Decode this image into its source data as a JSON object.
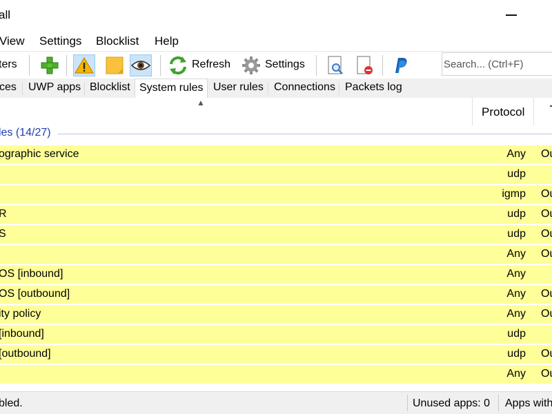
{
  "window": {
    "title": "all"
  },
  "menu": {
    "items": [
      "View",
      "Settings",
      "Blocklist",
      "Help"
    ]
  },
  "toolbar": {
    "filters_label": "ters",
    "refresh_label": "Refresh",
    "settings_label": "Settings",
    "search_placeholder": "Search... (Ctrl+F)"
  },
  "tabs": {
    "items": [
      "ces",
      "UWP apps",
      "Blocklist",
      "System rules",
      "User rules",
      "Connections",
      "Packets log"
    ],
    "active": "System rules"
  },
  "list": {
    "column_protocol": "Protocol",
    "group_label": "les (14/27)",
    "rows": [
      {
        "name": "ographic service",
        "protocol": "Any",
        "direction": "Ou"
      },
      {
        "name": "",
        "protocol": "udp",
        "direction": ""
      },
      {
        "name": "",
        "protocol": "igmp",
        "direction": "Ou"
      },
      {
        "name": "R",
        "protocol": "udp",
        "direction": "Ou"
      },
      {
        "name": "S",
        "protocol": "udp",
        "direction": "Ou"
      },
      {
        "name": "",
        "protocol": "Any",
        "direction": "Ou"
      },
      {
        "name": "OS [inbound]",
        "protocol": "Any",
        "direction": ""
      },
      {
        "name": "OS [outbound]",
        "protocol": "Any",
        "direction": "Ou"
      },
      {
        "name": "ity policy",
        "protocol": "Any",
        "direction": "Ou"
      },
      {
        "name": "[inbound]",
        "protocol": "udp",
        "direction": ""
      },
      {
        "name": "[outbound]",
        "protocol": "udp",
        "direction": "Ou"
      },
      {
        "name": "",
        "protocol": "Any",
        "direction": "Ou"
      }
    ]
  },
  "status": {
    "left": "bled.",
    "unused_apps": "Unused apps: 0",
    "apps_with": "Apps with"
  },
  "colors": {
    "row_highlight": "#ffff99",
    "group_text": "#1a3db5",
    "active_button": "#cce4f7"
  },
  "icons": {
    "add": "plus-icon",
    "warning": "warning-icon",
    "sticky": "note-icon",
    "eye": "eye-icon",
    "refresh": "refresh-icon",
    "settings": "gear-icon",
    "log": "magnifier-document-icon",
    "clear_log": "document-delete-icon",
    "donate": "paypal-icon"
  }
}
